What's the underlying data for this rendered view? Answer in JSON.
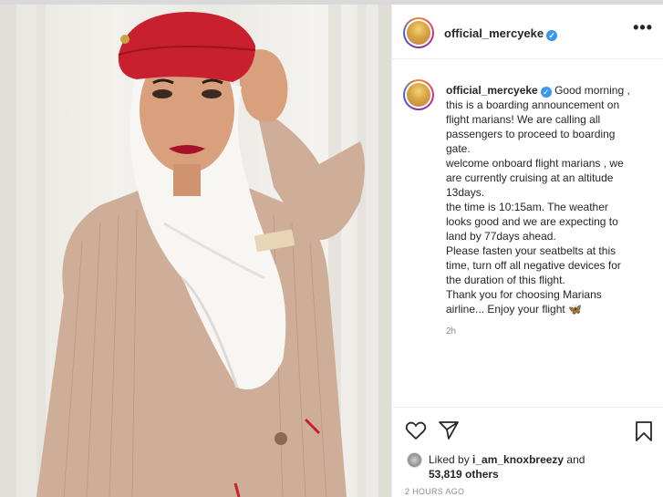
{
  "post": {
    "username": "official_mercyeke",
    "more_label": "•••",
    "caption_lines": [
      "Good morning ,",
      "this is a boarding announcement on",
      "flight marians! We are calling all",
      "passengers to proceed to boarding",
      "gate.",
      "welcome onboard flight marians , we",
      "are currently cruising at an altitude",
      "13days.",
      "the time is 10:15am. The weather",
      "looks good and we are expecting to",
      "land by 77days ahead.",
      "Please fasten your seatbelts at this",
      "time, turn off all negative devices for",
      "the duration of this flight.",
      "Thank you for choosing Marians",
      "airline... Enjoy your flight 🦋"
    ],
    "caption_time": "2h",
    "liked_prefix": "Liked by ",
    "liked_by": "i_am_knoxbreezy",
    "liked_mid": " and",
    "likes_count": "53,819 others",
    "post_date": "2 HOURS AGO"
  },
  "colors": {
    "verified": "#3897f0",
    "muted": "#8e8e8e",
    "text": "#262626",
    "beret": "#c8202e",
    "uniform": "#caa48e"
  },
  "icons": {
    "heart": "heart-icon",
    "share": "send-icon",
    "save": "bookmark-icon",
    "verified": "verified-badge-icon"
  }
}
